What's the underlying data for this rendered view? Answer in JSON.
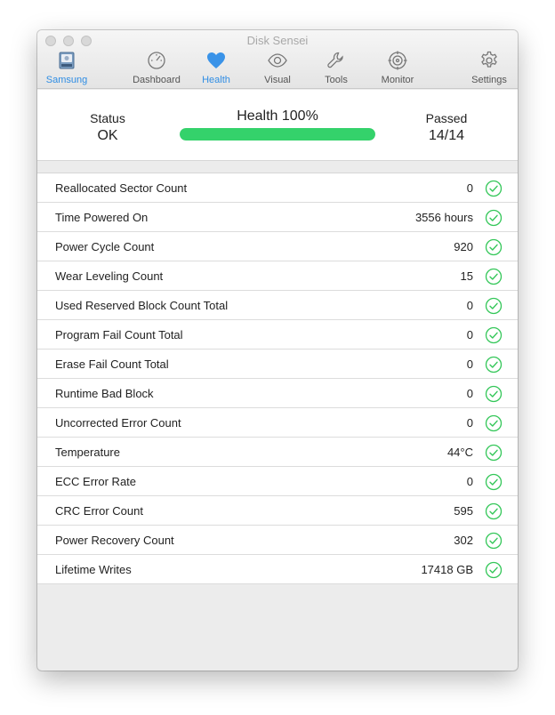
{
  "window": {
    "title": "Disk Sensei"
  },
  "toolbar": {
    "items": [
      {
        "label": "Samsung",
        "icon": "disk-icon",
        "active": false
      },
      {
        "label": "Dashboard",
        "icon": "gauge-icon",
        "active": false
      },
      {
        "label": "Health",
        "icon": "heart-icon",
        "active": true
      },
      {
        "label": "Visual",
        "icon": "eye-icon",
        "active": false
      },
      {
        "label": "Tools",
        "icon": "wrench-icon",
        "active": false
      },
      {
        "label": "Monitor",
        "icon": "target-icon",
        "active": false
      },
      {
        "label": "Settings",
        "icon": "gear-icon",
        "active": false
      }
    ],
    "accent": "#2f8de4"
  },
  "summary": {
    "status_label": "Status",
    "status_value": "OK",
    "health_title": "Health 100%",
    "health_percent": 100,
    "bar_color": "#34d26b",
    "passed_label": "Passed",
    "passed_value": "14/14"
  },
  "attributes": [
    {
      "name": "Reallocated Sector Count",
      "value": "0"
    },
    {
      "name": "Time Powered On",
      "value": "3556 hours"
    },
    {
      "name": "Power Cycle Count",
      "value": "920"
    },
    {
      "name": "Wear Leveling Count",
      "value": "15"
    },
    {
      "name": "Used Reserved Block Count Total",
      "value": "0"
    },
    {
      "name": "Program Fail Count Total",
      "value": "0"
    },
    {
      "name": "Erase Fail Count Total",
      "value": "0"
    },
    {
      "name": "Runtime Bad Block",
      "value": "0"
    },
    {
      "name": "Uncorrected Error Count",
      "value": "0"
    },
    {
      "name": "Temperature",
      "value": "44°C"
    },
    {
      "name": "ECC Error Rate",
      "value": "0"
    },
    {
      "name": "CRC Error Count",
      "value": "595"
    },
    {
      "name": "Power Recovery Count",
      "value": "302"
    },
    {
      "name": "Lifetime Writes",
      "value": "17418 GB"
    }
  ],
  "check_color": "#34c759"
}
